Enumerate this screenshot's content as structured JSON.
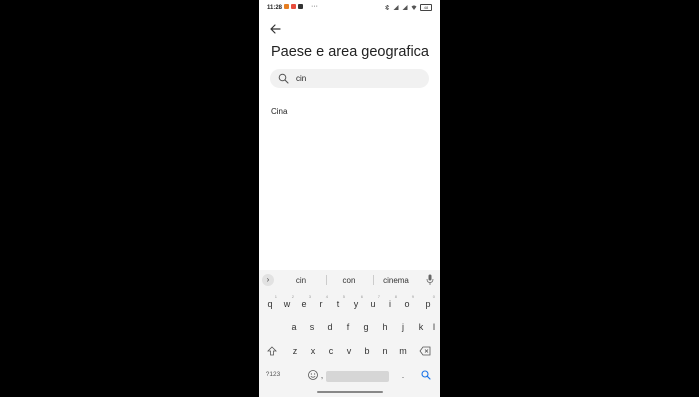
{
  "status_bar": {
    "time": "11:28",
    "dots": "···",
    "battery": "48"
  },
  "header": {
    "title": "Paese e area geografica"
  },
  "search": {
    "value": "cin",
    "placeholder": ""
  },
  "results": [
    {
      "label": "Cina"
    }
  ],
  "keyboard": {
    "suggestions": [
      "cin",
      "con",
      "cinema"
    ],
    "row1": [
      {
        "k": "q",
        "sup": "1"
      },
      {
        "k": "w",
        "sup": "2"
      },
      {
        "k": "e",
        "sup": "3"
      },
      {
        "k": "r",
        "sup": "4"
      },
      {
        "k": "t",
        "sup": "5"
      },
      {
        "k": "y",
        "sup": "6"
      },
      {
        "k": "u",
        "sup": "7"
      },
      {
        "k": "i",
        "sup": "8"
      },
      {
        "k": "o",
        "sup": "9"
      },
      {
        "k": "p",
        "sup": "0"
      }
    ],
    "row2": [
      "a",
      "s",
      "d",
      "f",
      "g",
      "h",
      "j",
      "k",
      "l"
    ],
    "row3": [
      "z",
      "x",
      "c",
      "v",
      "b",
      "n",
      "m"
    ],
    "symbols_label": "?123",
    "comma": ",",
    "period": "."
  },
  "colors": {
    "accent": "#1a73e8"
  }
}
